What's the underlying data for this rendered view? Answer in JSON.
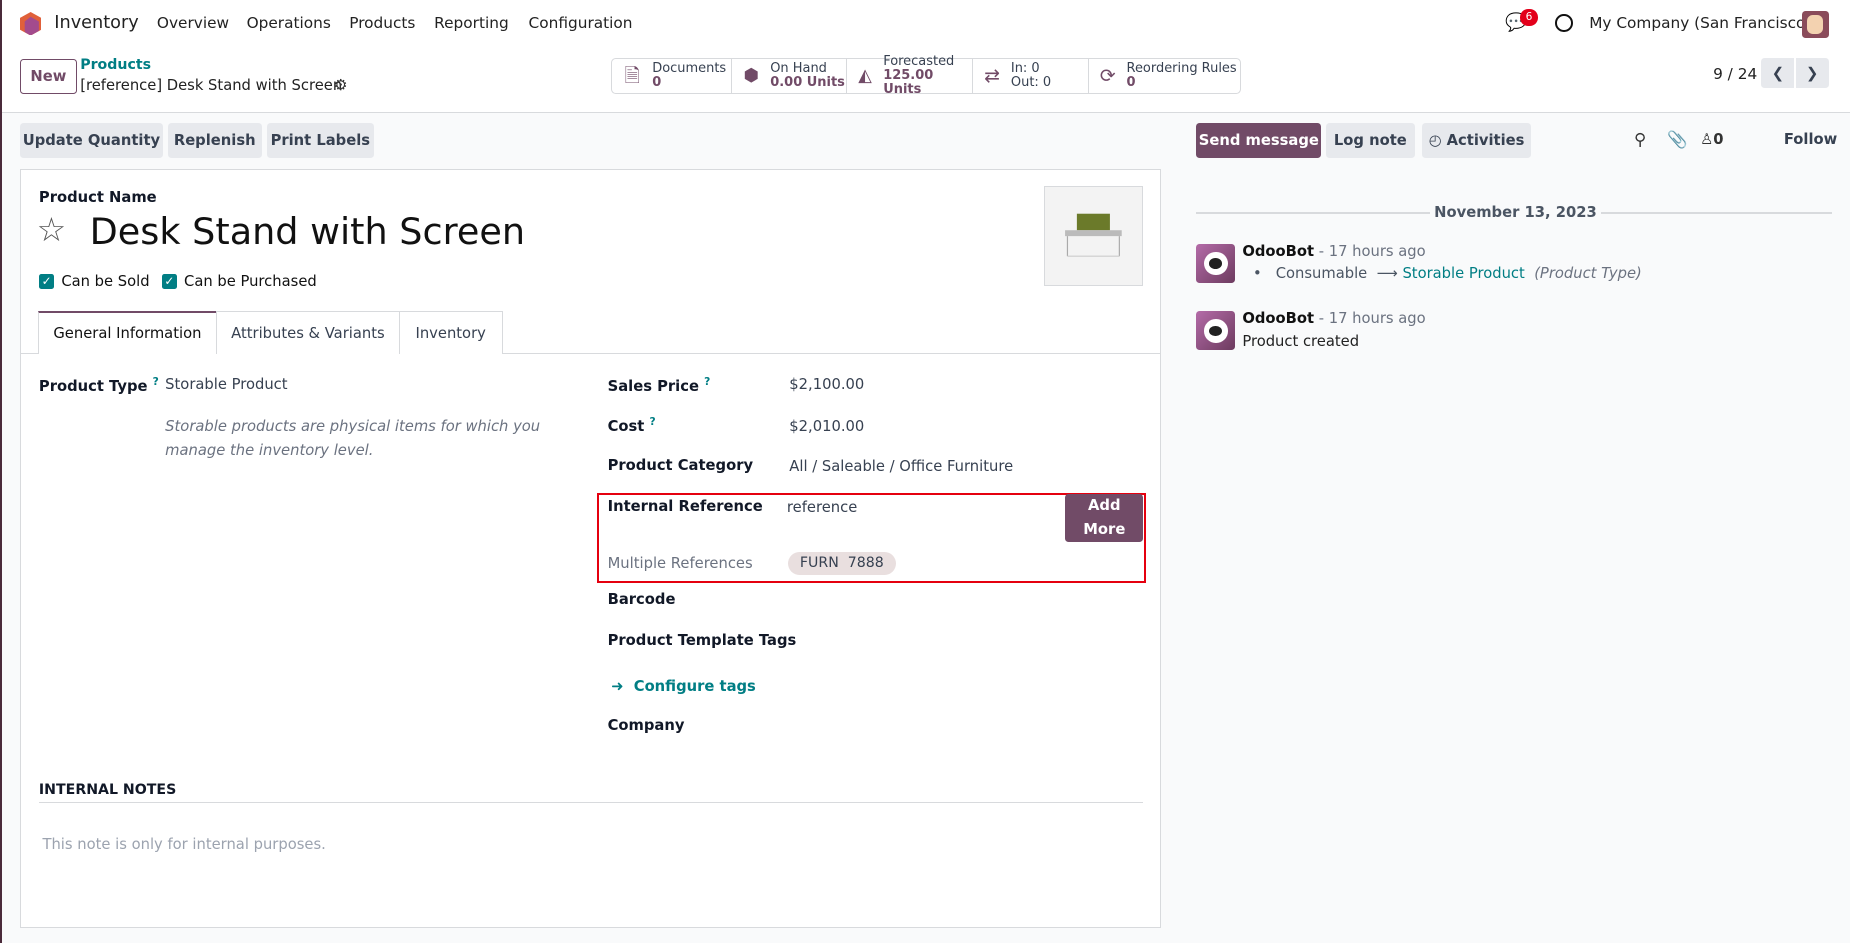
{
  "navbar": {
    "app": "Inventory",
    "menu": [
      "Overview",
      "Operations",
      "Products",
      "Reporting",
      "Configuration"
    ],
    "messages_badge": "6",
    "company": "My Company (San Francisco)"
  },
  "control_panel": {
    "new_label": "New",
    "breadcrumb_parent": "Products",
    "breadcrumb_current": "[reference] Desk Stand with Screen",
    "pager": "9 / 24",
    "stats": [
      {
        "label": "Documents",
        "value": "0"
      },
      {
        "label": "On Hand",
        "value": "0.00 Units"
      },
      {
        "label": "Forecasted",
        "value": "125.00 Units"
      },
      {
        "label": "In: 0",
        "value": "Out: 0"
      },
      {
        "label": "Reordering Rules",
        "value": "0"
      }
    ]
  },
  "actions": {
    "update_quantity": "Update Quantity",
    "replenish": "Replenish",
    "print_labels": "Print Labels"
  },
  "form": {
    "product_name_label": "Product Name",
    "product_name": "Desk Stand with Screen",
    "can_be_sold": "Can be Sold",
    "can_be_purchased": "Can be Purchased",
    "tabs": [
      "General Information",
      "Attributes & Variants",
      "Inventory"
    ],
    "product_type_label": "Product Type",
    "product_type": "Storable Product",
    "product_type_help": "Storable products are physical items for which you manage the inventory level.",
    "sales_price_label": "Sales Price",
    "sales_price": "$2,100.00",
    "cost_label": "Cost",
    "cost": "$2,010.00",
    "category_label": "Product Category",
    "category": "All / Saleable / Office Furniture",
    "internal_ref_label": "Internal Reference",
    "internal_ref": "reference",
    "add_more": "Add More",
    "multi_ref_label": "Multiple References",
    "multi_ref_tag": "FURN  7888",
    "barcode_label": "Barcode",
    "tags_label": "Product Template Tags",
    "configure_tags": "Configure tags",
    "company_label": "Company",
    "internal_notes_title": "INTERNAL NOTES",
    "internal_notes_placeholder": "This note is only for internal purposes."
  },
  "chatter": {
    "send_message": "Send message",
    "log_note": "Log note",
    "activities": "Activities",
    "followers": "0",
    "follow": "Follow",
    "date": "November 13, 2023",
    "messages": [
      {
        "author": "OdooBot",
        "time": "- 17 hours ago",
        "old": "Consumable",
        "new": "Storable Product",
        "field": "(Product Type)"
      },
      {
        "author": "OdooBot",
        "time": "- 17 hours ago",
        "body": "Product created"
      }
    ]
  }
}
